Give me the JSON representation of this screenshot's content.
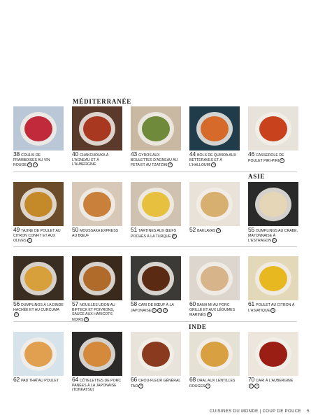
{
  "sections": {
    "mediterranee": "MÉDITERRANÉE",
    "asie": "ASIE",
    "inde": "INDE"
  },
  "recipes": [
    {
      "num": "38",
      "title": "COULIS DE FRAMBOISES AU VIN ROUGE",
      "icons": [
        "D",
        "V"
      ]
    },
    {
      "num": "40",
      "title": "CHAKCHOUKA À L'AGNEAU ET À L'AUBERGINE",
      "icons": []
    },
    {
      "num": "43",
      "title": "GYROS AUX BOULETTES D'AGNEAU AU FETA ET AU TZATZIKI",
      "icons": [
        "R"
      ]
    },
    {
      "num": "44",
      "title": "BOLS DE QUINOA AUX BETTERAVES ET À L'HALLOUMI",
      "icons": [
        "V"
      ]
    },
    {
      "num": "46",
      "title": "CASSEROLE DE POULET PIRI-PIRI",
      "icons": [
        "C"
      ]
    },
    {
      "num": "49",
      "title": "TAJINE DE POULET AU CITRON CONFIT ET AUX OLIVES",
      "icons": [
        "C"
      ]
    },
    {
      "num": "50",
      "title": "MOUSSAKA EXPRESS AU BŒUF",
      "icons": []
    },
    {
      "num": "51",
      "title": "TARTINES AUX ŒUFS POCHÉS À LA TURQUE",
      "icons": [
        "R"
      ]
    },
    {
      "num": "52",
      "title": "BAKLAVAS",
      "icons": [
        "C"
      ]
    },
    {
      "num": "55",
      "title": "DUMPLINGS AU CRABE, MAYONNAISE À L'ESTRAGON",
      "icons": [
        "C"
      ]
    },
    {
      "num": "56",
      "title": "DUMPLINGS À LA DINDE HACHÉE ET AU CURCUMA",
      "icons": [
        "C"
      ]
    },
    {
      "num": "57",
      "title": "NOUILLES UDON AU BIFTECK ET POIVRONS, SAUCE AUX HARICOTS NOIRS",
      "icons": [
        "R"
      ]
    },
    {
      "num": "58",
      "title": "CARI DE BŒUF À LA JAPONAISE",
      "icons": [
        "C",
        "D",
        "S"
      ]
    },
    {
      "num": "60",
      "title": "BANH MI AU PORC GRILLÉ ET AUX LÉGUMES MARINÉS",
      "icons": [
        "R"
      ]
    },
    {
      "num": "61",
      "title": "POULET AU CITRON À L'ASIATIQUE",
      "icons": [
        "S"
      ]
    },
    {
      "num": "62",
      "title": "PAD THAÏ AU POULET",
      "icons": []
    },
    {
      "num": "64",
      "title": "CÔTELETTES DE PORC PANÉES À LA JAPONAISE (TONKATSU)",
      "icons": []
    },
    {
      "num": "66",
      "title": "CHOU-FLEUR GÉNÉRAL TAO",
      "icons": [
        "R"
      ]
    },
    {
      "num": "68",
      "title": "DHAL AUX LENTILLES ROUGES",
      "icons": [
        "V"
      ]
    },
    {
      "num": "70",
      "title": "CARI À L'AUBERGINE",
      "icons": [
        "D",
        "V"
      ]
    }
  ],
  "footer": {
    "text": "CUISINES DU MONDE  |  COUP DE POUCE",
    "page": "5"
  },
  "colors": {
    "photo_tones": [
      "#b9c7d6",
      "#5a3a2a",
      "#c9b9a3",
      "#203c4a",
      "#e7e2da",
      "#6a4b2a",
      "#d8c8b8",
      "#cfc2b0",
      "#e9e2d8",
      "#2a2a2a",
      "#3a2e22",
      "#3a2a1c",
      "#3c3a36",
      "#dcd6cf",
      "#e3d8b8",
      "#d7e3ea",
      "#2b2a28",
      "#e8e4dc",
      "#e6e1d5",
      "#ece6dc"
    ],
    "food_tones": [
      "#c02a3a",
      "#a83820",
      "#6e8a3a",
      "#d66a2a",
      "#c8421e",
      "#c48a2a",
      "#c8803a",
      "#e8c040",
      "#d7b070",
      "#e6d6b8",
      "#d8a03a",
      "#b06a2a",
      "#5a2a12",
      "#d8b48a",
      "#e8b820",
      "#e0a050",
      "#d48a3a",
      "#8a3a1e",
      "#d8a040",
      "#9a1e14"
    ]
  }
}
